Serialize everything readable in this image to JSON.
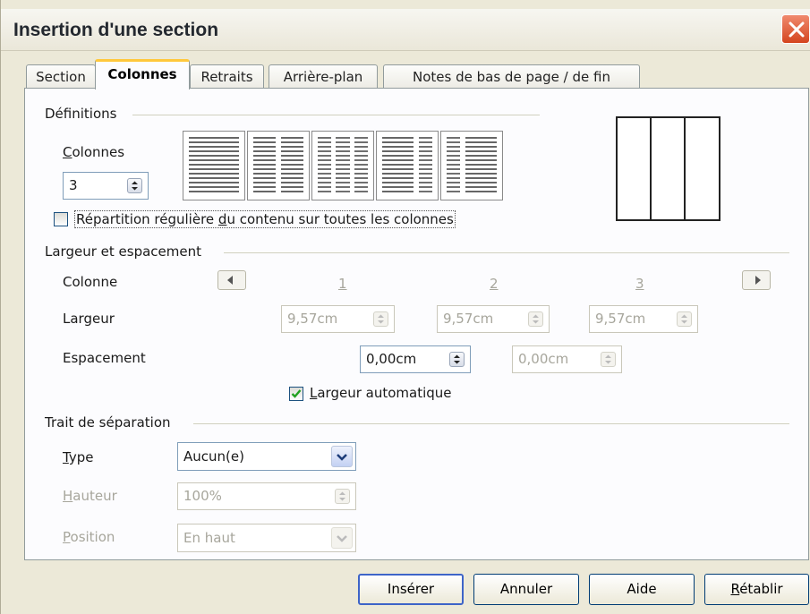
{
  "window": {
    "title": "Insertion d'une section"
  },
  "tabs": [
    {
      "label": "Section",
      "active": false
    },
    {
      "label": "Colonnes",
      "active": true
    },
    {
      "label": "Retraits",
      "active": false
    },
    {
      "label": "Arrière-plan",
      "active": false
    },
    {
      "label": "Notes de bas de page / de fin",
      "active": false
    }
  ],
  "definitions": {
    "group_label": "Définitions",
    "columns_label_mn": "C",
    "columns_label_rest": "olonnes",
    "columns_value": "3",
    "layout_presets": [
      "1 colonne",
      "2 colonnes",
      "3 colonnes",
      "2 colonnes (gauche large)",
      "2 colonnes (droite large)"
    ],
    "even_distribution": {
      "text_a": "Répartition régulière ",
      "text_mn": "d",
      "text_b": "u contenu sur toutes les colonnes",
      "checked": false
    },
    "preview_columns": 3
  },
  "width_spacing": {
    "group_label": "Largeur et espacement",
    "column_label": "Colonne",
    "column_numbers": [
      "1",
      "2",
      "3"
    ],
    "width_label": "Largeur",
    "widths": [
      "9,57cm",
      "9,57cm",
      "9,57cm"
    ],
    "spacing_label": "Espacement",
    "spacings": [
      "0,00cm",
      "0,00cm"
    ],
    "auto_width": {
      "mn": "L",
      "rest": "argeur automatique",
      "checked": true
    }
  },
  "separator": {
    "group_label": "Trait de séparation",
    "type_mn": "T",
    "type_rest": "ype",
    "type_value": "Aucun(e)",
    "height_mn": "H",
    "height_rest": "auteur",
    "height_value": "100%",
    "position_mn": "P",
    "position_rest": "osition",
    "position_value": "En haut"
  },
  "buttons": {
    "insert": "Insérer",
    "cancel": "Annuler",
    "help": "Aide",
    "reset_mn": "R",
    "reset_rest": "établir"
  },
  "colors": {
    "active_tab_accent": "#ffc83c",
    "close_button": "#d4451f",
    "dialog_bg": "#ece9d8"
  }
}
